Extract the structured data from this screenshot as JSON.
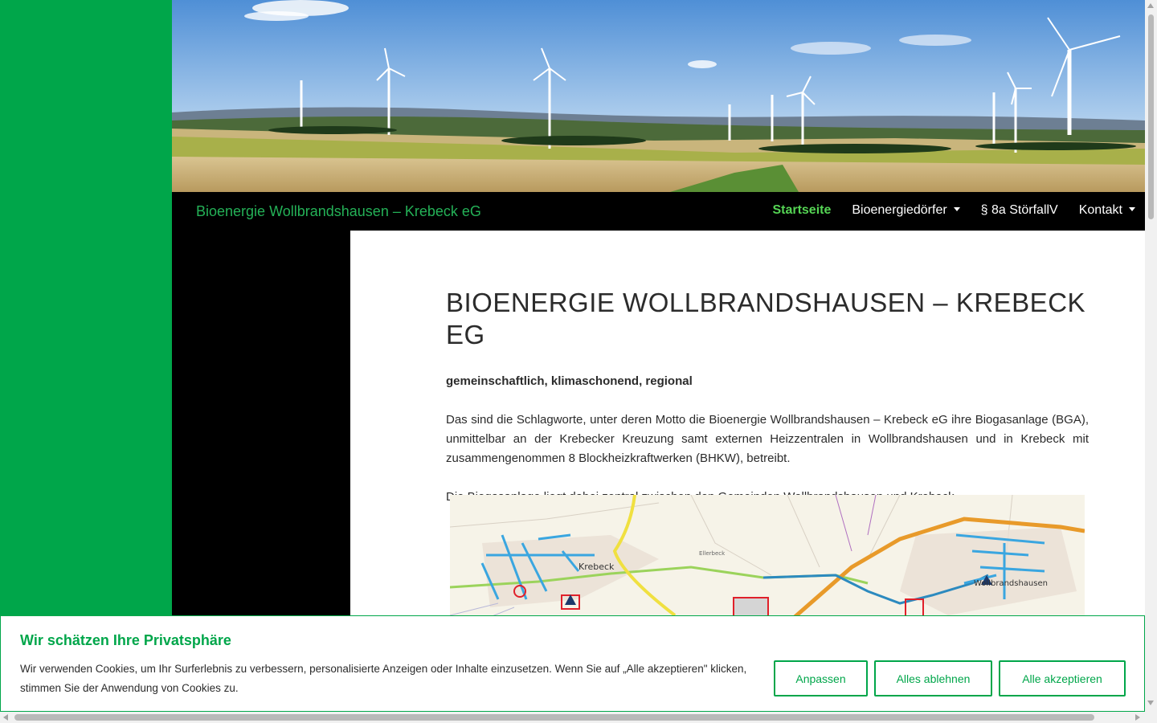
{
  "header": {
    "site_title": "Bioenergie Wollbrandshausen – Krebeck eG",
    "menu": [
      {
        "label": "Startseite",
        "active": true,
        "dropdown": false
      },
      {
        "label": "Bioenergiedörfer",
        "active": false,
        "dropdown": true
      },
      {
        "label": "§ 8a StörfallV",
        "active": false,
        "dropdown": false
      },
      {
        "label": "Kontakt",
        "active": false,
        "dropdown": true
      }
    ]
  },
  "main": {
    "title": "BIOENERGIE WOLLBRANDSHAUSEN – KREBECK EG",
    "tagline": "gemeinschaftlich, klimaschonend, regional",
    "paragraph1": "Das sind die Schlagworte, unter deren Motto die Bioenergie Wollbrandshausen – Krebeck eG ihre Biogasanlage (BGA), unmittelbar an der Krebecker Kreuzung samt externen Heizzentralen in Wollbrandshausen und in Krebeck mit zusammengenommen 8 Blockheizkraftwerken (BHKW), betreibt.",
    "paragraph2": "Die Biogasanlage liegt dabei zentral zwischen den Gemeinden Wollbrandshausen und Krebeck.",
    "map": {
      "label_krebeck": "Krebeck",
      "label_wollbrandshausen": "Wollbrandshausen",
      "label_eller": "Ellerbeck"
    }
  },
  "cookie": {
    "title": "Wir schätzen Ihre Privatsphäre",
    "text": "Wir verwenden Cookies, um Ihr Surferlebnis zu verbessern, personalisierte Anzeigen oder Inhalte einzusetzen. Wenn Sie auf „Alle akzeptieren\" klicken, stimmen Sie der Anwendung von Cookies zu.",
    "btn_customize": "Anpassen",
    "btn_reject": "Alles ablehnen",
    "btn_accept": "Alle akzeptieren"
  },
  "colors": {
    "brand_green": "#00a64a",
    "title_green": "#24b157",
    "active_menu": "#55d454"
  }
}
